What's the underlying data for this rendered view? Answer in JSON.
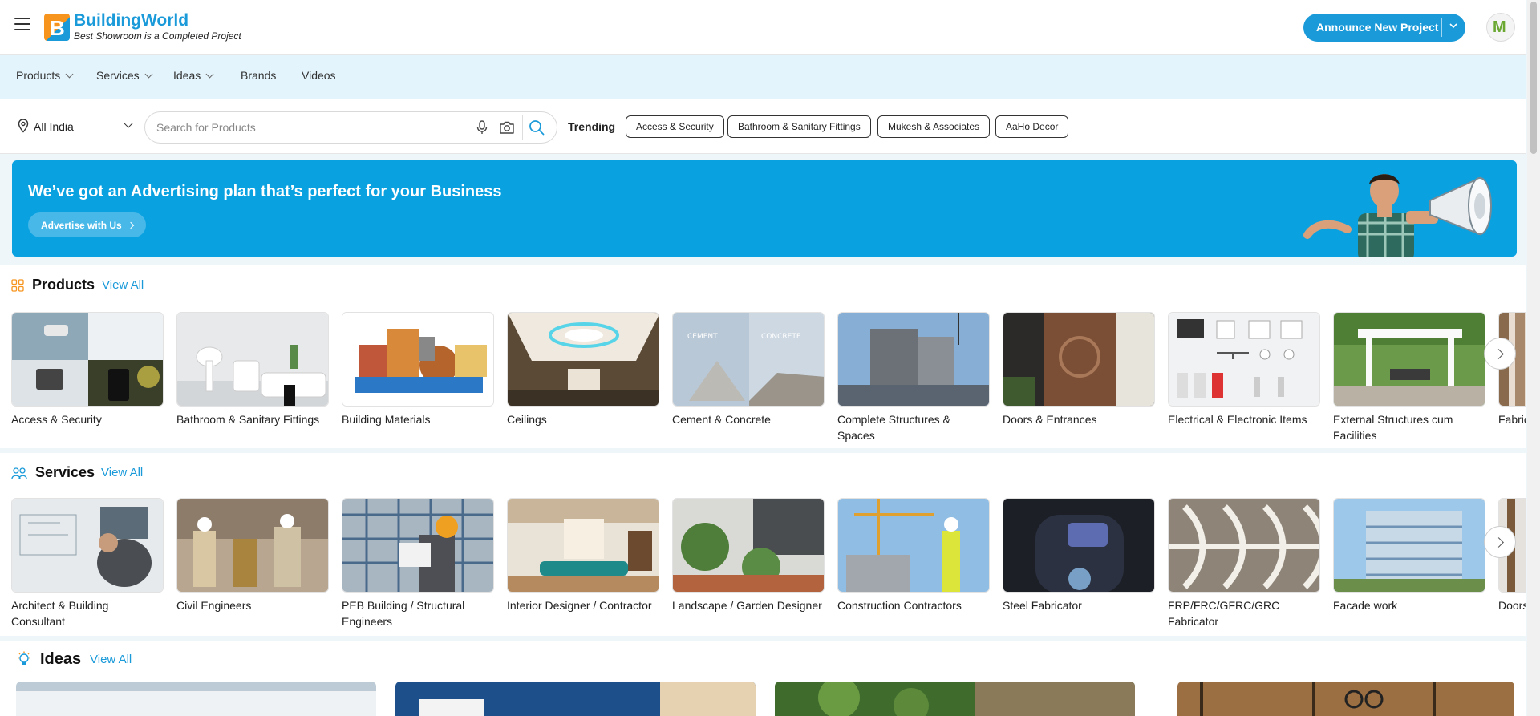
{
  "header": {
    "brand_name": "BuildingWorld",
    "brand_tagline": "Best Showroom is a Completed Project",
    "announce_label": "Announce New Project",
    "brand_color": "#1a9ad9"
  },
  "nav": {
    "items": [
      {
        "label": "Products",
        "has_dropdown": true
      },
      {
        "label": "Services",
        "has_dropdown": true
      },
      {
        "label": "Ideas",
        "has_dropdown": true
      },
      {
        "label": "Brands",
        "has_dropdown": false
      },
      {
        "label": "Videos",
        "has_dropdown": false
      }
    ]
  },
  "search": {
    "location": "All India",
    "placeholder": "Search for Products",
    "trending_label": "Trending",
    "trending": [
      "Access & Security",
      "Bathroom & Sanitary Fittings",
      "Mukesh & Associates",
      "AaHo Decor"
    ]
  },
  "banner": {
    "title": "We’ve got an Advertising plan that’s perfect for your Business",
    "button": "Advertise with Us",
    "bg_color": "#0aa1e1"
  },
  "products": {
    "title": "Products",
    "view_all": "View All",
    "items": [
      {
        "label": "Access & Security"
      },
      {
        "label": "Bathroom & Sanitary Fittings"
      },
      {
        "label": "Building Materials"
      },
      {
        "label": "Ceilings"
      },
      {
        "label": "Cement & Concrete"
      },
      {
        "label": "Complete Structures & Spaces"
      },
      {
        "label": "Doors & Entrances"
      },
      {
        "label": "Electrical & Electronic Items"
      },
      {
        "label": "External Structures cum Facilities"
      },
      {
        "label": "Fabric"
      }
    ],
    "image_text": {
      "cement": "CEMENT",
      "concrete": "CONCRETE"
    }
  },
  "services": {
    "title": "Services",
    "view_all": "View All",
    "items": [
      {
        "label": "Architect & Building Consultant"
      },
      {
        "label": "Civil Engineers"
      },
      {
        "label": "PEB Building / Structural Engineers"
      },
      {
        "label": "Interior Designer / Contractor"
      },
      {
        "label": "Landscape / Garden Designer"
      },
      {
        "label": "Construction Contractors"
      },
      {
        "label": "Steel Fabricator"
      },
      {
        "label": "FRP/FRC/GFRC/GRC Fabricator"
      },
      {
        "label": "Facade work"
      },
      {
        "label": "Doors"
      }
    ]
  },
  "ideas": {
    "title": "Ideas",
    "view_all": "View All"
  }
}
